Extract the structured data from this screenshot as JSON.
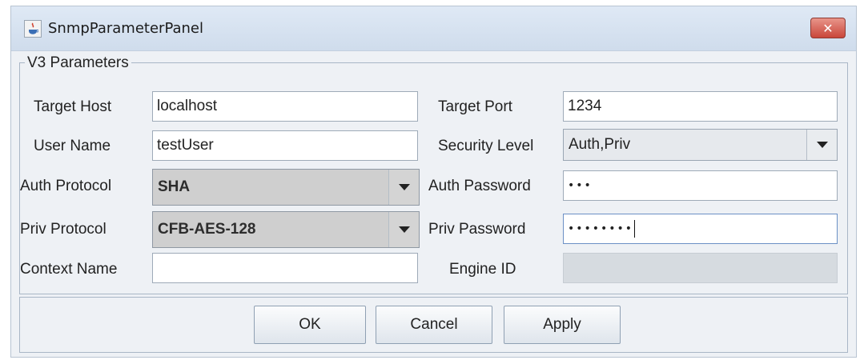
{
  "window": {
    "title": "SnmpParameterPanel",
    "close_label": "✕"
  },
  "fieldset": {
    "legend": "V3 Parameters"
  },
  "fields": {
    "target_host": {
      "label": "Target Host",
      "value": "localhost"
    },
    "target_port": {
      "label": "Target Port",
      "value": "1234"
    },
    "user_name": {
      "label": "User Name",
      "value": "testUser"
    },
    "security_level": {
      "label": "Security Level",
      "value": "Auth,Priv"
    },
    "auth_protocol": {
      "label": "Auth Protocol",
      "value": "SHA"
    },
    "auth_password": {
      "label": "Auth Password",
      "value": "•••"
    },
    "priv_protocol": {
      "label": "Priv Protocol",
      "value": "CFB-AES-128"
    },
    "priv_password": {
      "label": "Priv Password",
      "value": "••••••••"
    },
    "context_name": {
      "label": "Context Name",
      "value": ""
    },
    "engine_id": {
      "label": "Engine ID",
      "value": ""
    }
  },
  "buttons": {
    "ok": "OK",
    "cancel": "Cancel",
    "apply": "Apply"
  }
}
